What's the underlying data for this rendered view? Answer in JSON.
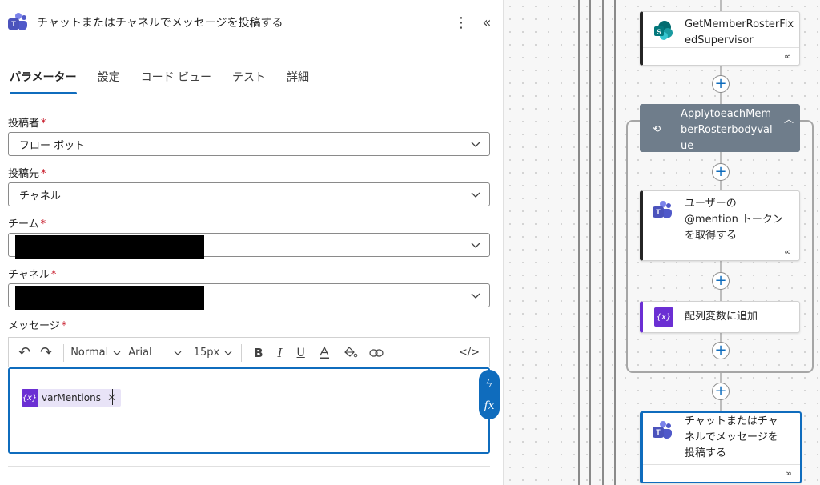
{
  "panel": {
    "title": "チャットまたはチャネルでメッセージを投稿する",
    "more_icon": "⋮",
    "collapse_icon": "«"
  },
  "tabs": [
    {
      "label": "パラメーター",
      "active": true
    },
    {
      "label": "設定"
    },
    {
      "label": "コード ビュー"
    },
    {
      "label": "テスト"
    },
    {
      "label": "詳細"
    }
  ],
  "fields": {
    "poster": {
      "label": "投稿者",
      "value": "フロー ボット"
    },
    "post_in": {
      "label": "投稿先",
      "value": "チャネル"
    },
    "team": {
      "label": "チーム",
      "value": ""
    },
    "channel": {
      "label": "チャネル",
      "value": ""
    },
    "message": {
      "label": "メッセージ"
    }
  },
  "required_mark": "*",
  "toolbar": {
    "undo": "↶",
    "redo": "↷",
    "style": "Normal",
    "font": "Arial",
    "size": "15px",
    "bold": "B",
    "italic": "I",
    "underline": "U",
    "code": "</>"
  },
  "editor": {
    "token_icon": "{x}",
    "token_label": "varMentions",
    "token_remove": "✕"
  },
  "side_pill": {
    "lightning": "ϟ",
    "fx": "fx"
  },
  "flow": {
    "step1": "GetMemberRosterFix\nedSupervisor",
    "loop": "ApplytoeachMem\nberRosterbodyval\nue",
    "step2": "ユーザーの\n@mention トークン\nを取得する",
    "step3": "配列変数に追加",
    "step4": "チャットまたはチャ\nネルでメッセージを\n投稿する",
    "plus": "+",
    "var_icon": "{x}"
  },
  "colors": {
    "accent": "#0f6cbd",
    "variable": "#6b2fd3",
    "loop": "#6f7d8b",
    "required": "#c50f1f"
  }
}
